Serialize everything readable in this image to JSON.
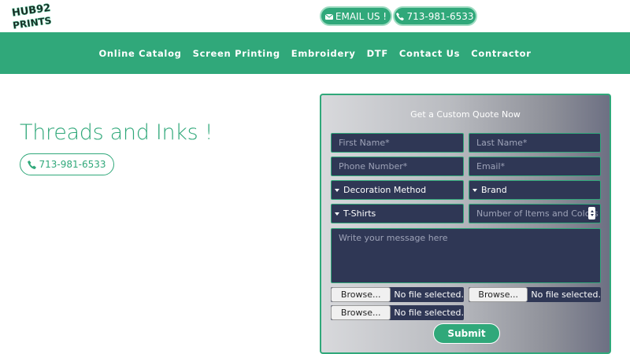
{
  "header": {
    "logo_text_top": "HUB92",
    "logo_text_bottom": "PRINTS",
    "email_label": "EMAIL US !",
    "phone_label": "713-981-6533"
  },
  "nav": {
    "items": [
      "Online Catalog",
      "Screen Printing",
      "Embroidery",
      "DTF",
      "Contact Us",
      "Contractor"
    ]
  },
  "hero": {
    "title": "Threads and Inks !",
    "phone_label": "713-981-6533"
  },
  "quote_form": {
    "title": "Get a Custom Quote Now",
    "first_name_placeholder": "First Name*",
    "last_name_placeholder": "Last Name*",
    "phone_placeholder": "Phone Number*",
    "email_placeholder": "Email*",
    "decoration_method": "Decoration Method",
    "brand": "Brand",
    "product_type": "T-Shirts",
    "quantity_placeholder": "Number of Items and Colors",
    "message_placeholder": "Write your message here",
    "browse_label": "Browse...",
    "no_file_label": "No file selected.",
    "submit_label": "Submit"
  },
  "colors": {
    "accent": "#30a87a",
    "field_bg": "#2f3755"
  }
}
